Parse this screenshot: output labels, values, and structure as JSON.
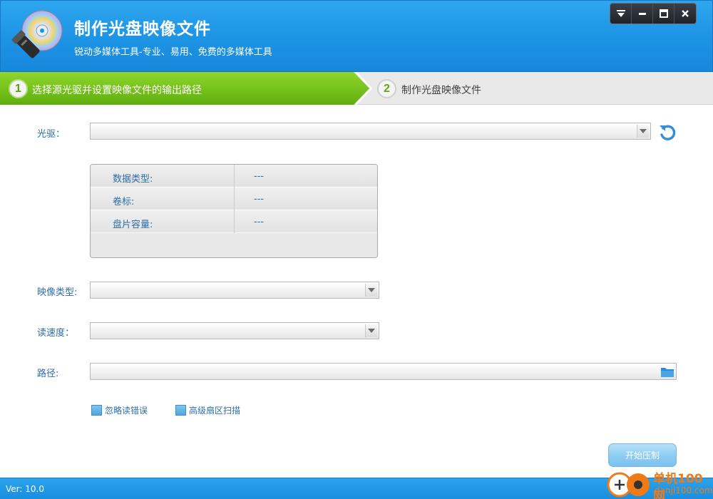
{
  "app": {
    "title": "制作光盘映像文件",
    "subtitle": "锐动多媒体工具-专业、易用、免费的多媒体工具"
  },
  "window_controls": [
    "menu-icon",
    "minimize-icon",
    "maximize-icon",
    "close-icon"
  ],
  "steps": [
    {
      "number": "1",
      "label": "选择源光驱并设置映像文件的输出路径",
      "active": true
    },
    {
      "number": "2",
      "label": "制作光盘映像文件",
      "active": false
    }
  ],
  "form": {
    "drive_label": "光驱：",
    "drive_value": "",
    "info": [
      {
        "key": "数据类型:",
        "value": "---"
      },
      {
        "key": "卷标:",
        "value": "---"
      },
      {
        "key": "盘片容量:",
        "value": "---"
      }
    ],
    "image_type_label": "映像类型:",
    "image_type_value": "",
    "read_speed_label": "读速度：",
    "read_speed_value": "",
    "path_label": "路径:",
    "path_value": "",
    "ignore_errors_label": "忽略读错误",
    "advanced_scan_label": "高级扇区扫描",
    "start_button_label": "开始压制"
  },
  "status": {
    "version": "Ver: 10.0"
  },
  "watermark": {
    "line1": "单机100网",
    "line2": "danji100.com"
  },
  "colors": {
    "header_blue": "#1d93e4",
    "step_active_green": "#76c61a",
    "label_blue": "#2d6ea8",
    "watermark_orange": "#f07b16"
  }
}
